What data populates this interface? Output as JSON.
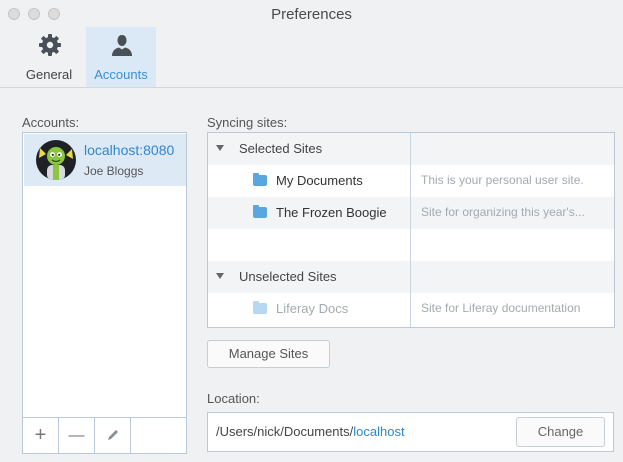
{
  "window": {
    "title": "Preferences"
  },
  "toolbar": {
    "general_label": "General",
    "general_icon": "gear-icon",
    "accounts_label": "Accounts",
    "accounts_icon": "user-icon"
  },
  "accounts": {
    "label": "Accounts:",
    "items": [
      {
        "host": "localhost:8080",
        "user": "Joe Bloggs",
        "selected": true
      }
    ],
    "footer": {
      "add": "+",
      "remove": "—"
    }
  },
  "syncing": {
    "label": "Syncing sites:",
    "groups": [
      {
        "label": "Selected Sites",
        "sites": [
          {
            "name": "My Documents",
            "description": "This is your personal user site."
          },
          {
            "name": "The Frozen Boogie",
            "description": "Site for organizing this year's..."
          }
        ]
      },
      {
        "label": "Unselected Sites",
        "sites": [
          {
            "name": "Liferay Docs",
            "description": "Site for Liferay documentation"
          }
        ]
      }
    ],
    "manage_button": "Manage Sites"
  },
  "location": {
    "label": "Location:",
    "path_prefix": "/Users/nick/Documents/",
    "path_host": "localhost",
    "change_button": "Change"
  },
  "colors": {
    "accent": "#2f86d1",
    "selected_bg": "#ddeaf6",
    "folder_selected": "#5aa7e0",
    "folder_unselected": "#b7d8f2"
  }
}
